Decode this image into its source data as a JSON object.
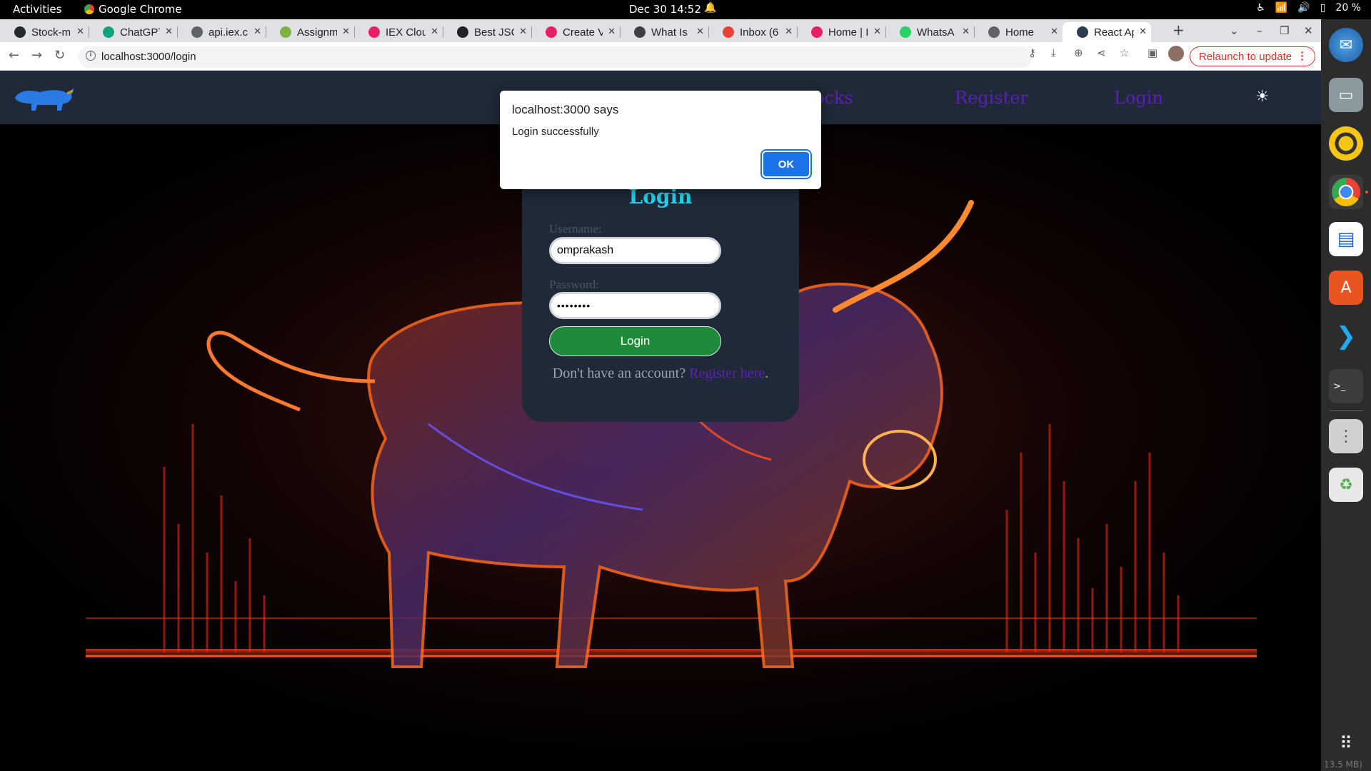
{
  "system_bar": {
    "activities": "Activities",
    "app_name": "Google Chrome",
    "clock": "Dec 30  14:52",
    "battery": "20 %"
  },
  "tabs": [
    {
      "label": "Stock-m",
      "icon": "github-icon",
      "color": "#24292f"
    },
    {
      "label": "ChatGPT",
      "icon": "chatgpt-icon",
      "color": "#10a37f"
    },
    {
      "label": "api.iex.c",
      "icon": "globe-icon",
      "color": "#5f6368"
    },
    {
      "label": "Assignm",
      "icon": "assignment-icon",
      "color": "#7cb342"
    },
    {
      "label": "IEX Clou",
      "icon": "iex-icon",
      "color": "#e91e63"
    },
    {
      "label": "Best JSC",
      "icon": "cb-icon",
      "color": "#202124"
    },
    {
      "label": "Create V",
      "icon": "iex-icon",
      "color": "#e91e63"
    },
    {
      "label": "What Is",
      "icon": "page-icon",
      "color": "#3c4043"
    },
    {
      "label": "Inbox (6",
      "icon": "gmail-icon",
      "color": "#ea4335"
    },
    {
      "label": "Home | I",
      "icon": "iex-icon",
      "color": "#e91e63"
    },
    {
      "label": "WhatsA",
      "icon": "whatsapp-icon",
      "color": "#25d366"
    },
    {
      "label": "Home",
      "icon": "home-page-icon",
      "color": "#5f6368"
    },
    {
      "label": "React Ap",
      "icon": "react-icon",
      "color": "#2c3e50",
      "active": true
    }
  ],
  "address_bar": {
    "url": "localhost:3000/login",
    "relaunch_label": "Relaunch to update"
  },
  "site_nav": {
    "stocks_partial": "ocks",
    "register": "Register",
    "login": "Login"
  },
  "login_form": {
    "title": "Login",
    "username_label": "Username:",
    "username_value": "omprakash",
    "password_label": "Password:",
    "password_value": "••••••••",
    "button": "Login",
    "footer_text": "Don't have an account?",
    "footer_link": "Register here",
    "footer_end": "."
  },
  "alert": {
    "title": "localhost:3000 says",
    "message": "Login successfully",
    "ok": "OK"
  },
  "dock": {
    "memory_label": "13.5 MB)"
  },
  "colors": {
    "navbar": "#1f2937",
    "accent_cyan": "#22d3ee",
    "link_purple": "#5b21b6",
    "login_green": "#1e8a3a",
    "dialog_blue": "#1a73e8"
  }
}
